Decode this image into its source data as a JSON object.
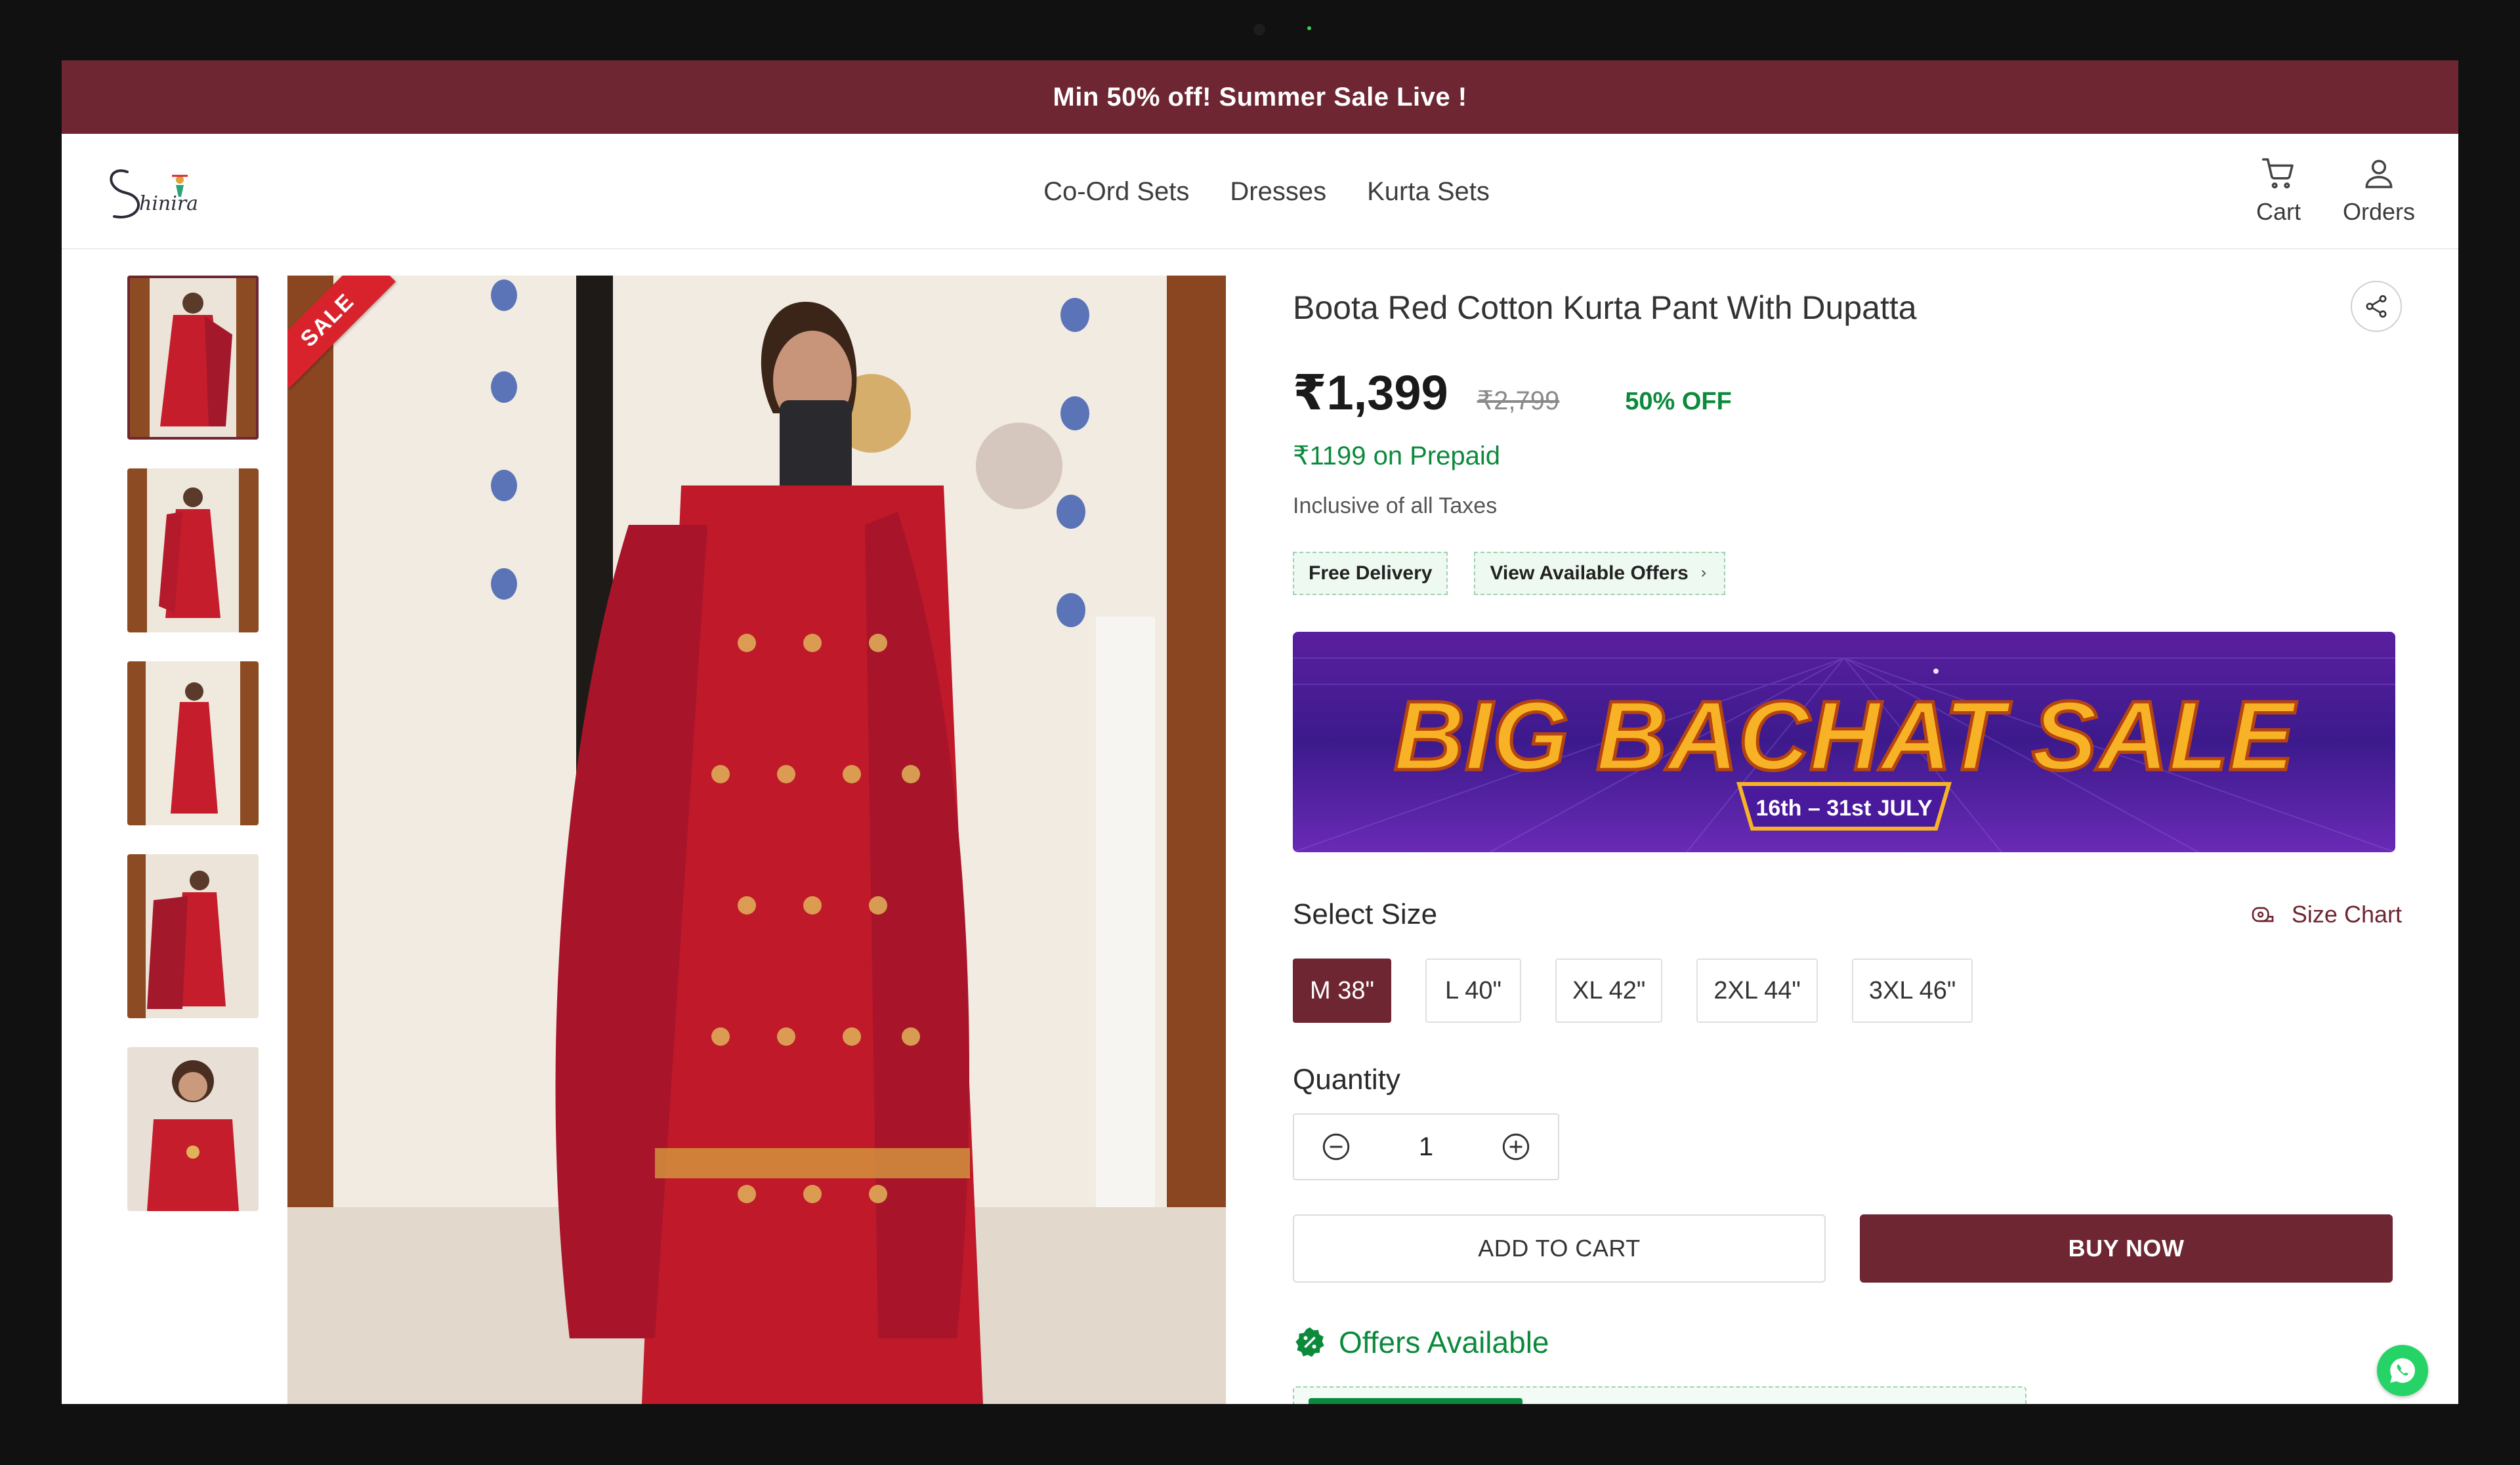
{
  "promo_bar": {
    "text": "Min 50% off! Summer Sale Live !"
  },
  "brand": {
    "logo_text": "Shinira",
    "accent_color": "#6e2632"
  },
  "nav": {
    "items": [
      "Co-Ord Sets",
      "Dresses",
      "Kurta Sets"
    ]
  },
  "header_actions": {
    "cart_label": "Cart",
    "orders_label": "Orders"
  },
  "gallery": {
    "thumbnail_count": 5,
    "active_index": 0
  },
  "main_image": {
    "ribbon": "SALE"
  },
  "product": {
    "title": "Boota Red Cotton Kurta Pant With Dupatta",
    "price": "₹1,399",
    "mrp": "₹2,799",
    "discount": "50% OFF",
    "prepaid_offer": "₹1199 on Prepaid",
    "tax_note": "Inclusive of all Taxes"
  },
  "badges": {
    "free_delivery": "Free Delivery",
    "view_offers": "View Available Offers"
  },
  "banner": {
    "headline": "BIG BACHAT SALE",
    "dates": "16th – 31st JULY"
  },
  "size": {
    "label": "Select Size",
    "chart_label": "Size Chart",
    "options": [
      "M 38\"",
      "L 40\"",
      "XL 42\"",
      "2XL 44\"",
      "3XL 46\""
    ],
    "selected": "M 38\""
  },
  "quantity": {
    "label": "Quantity",
    "value": "1"
  },
  "actions": {
    "add_to_cart": "ADD TO CART",
    "buy_now": "BUY NOW"
  },
  "offers": {
    "title": "Offers Available"
  }
}
